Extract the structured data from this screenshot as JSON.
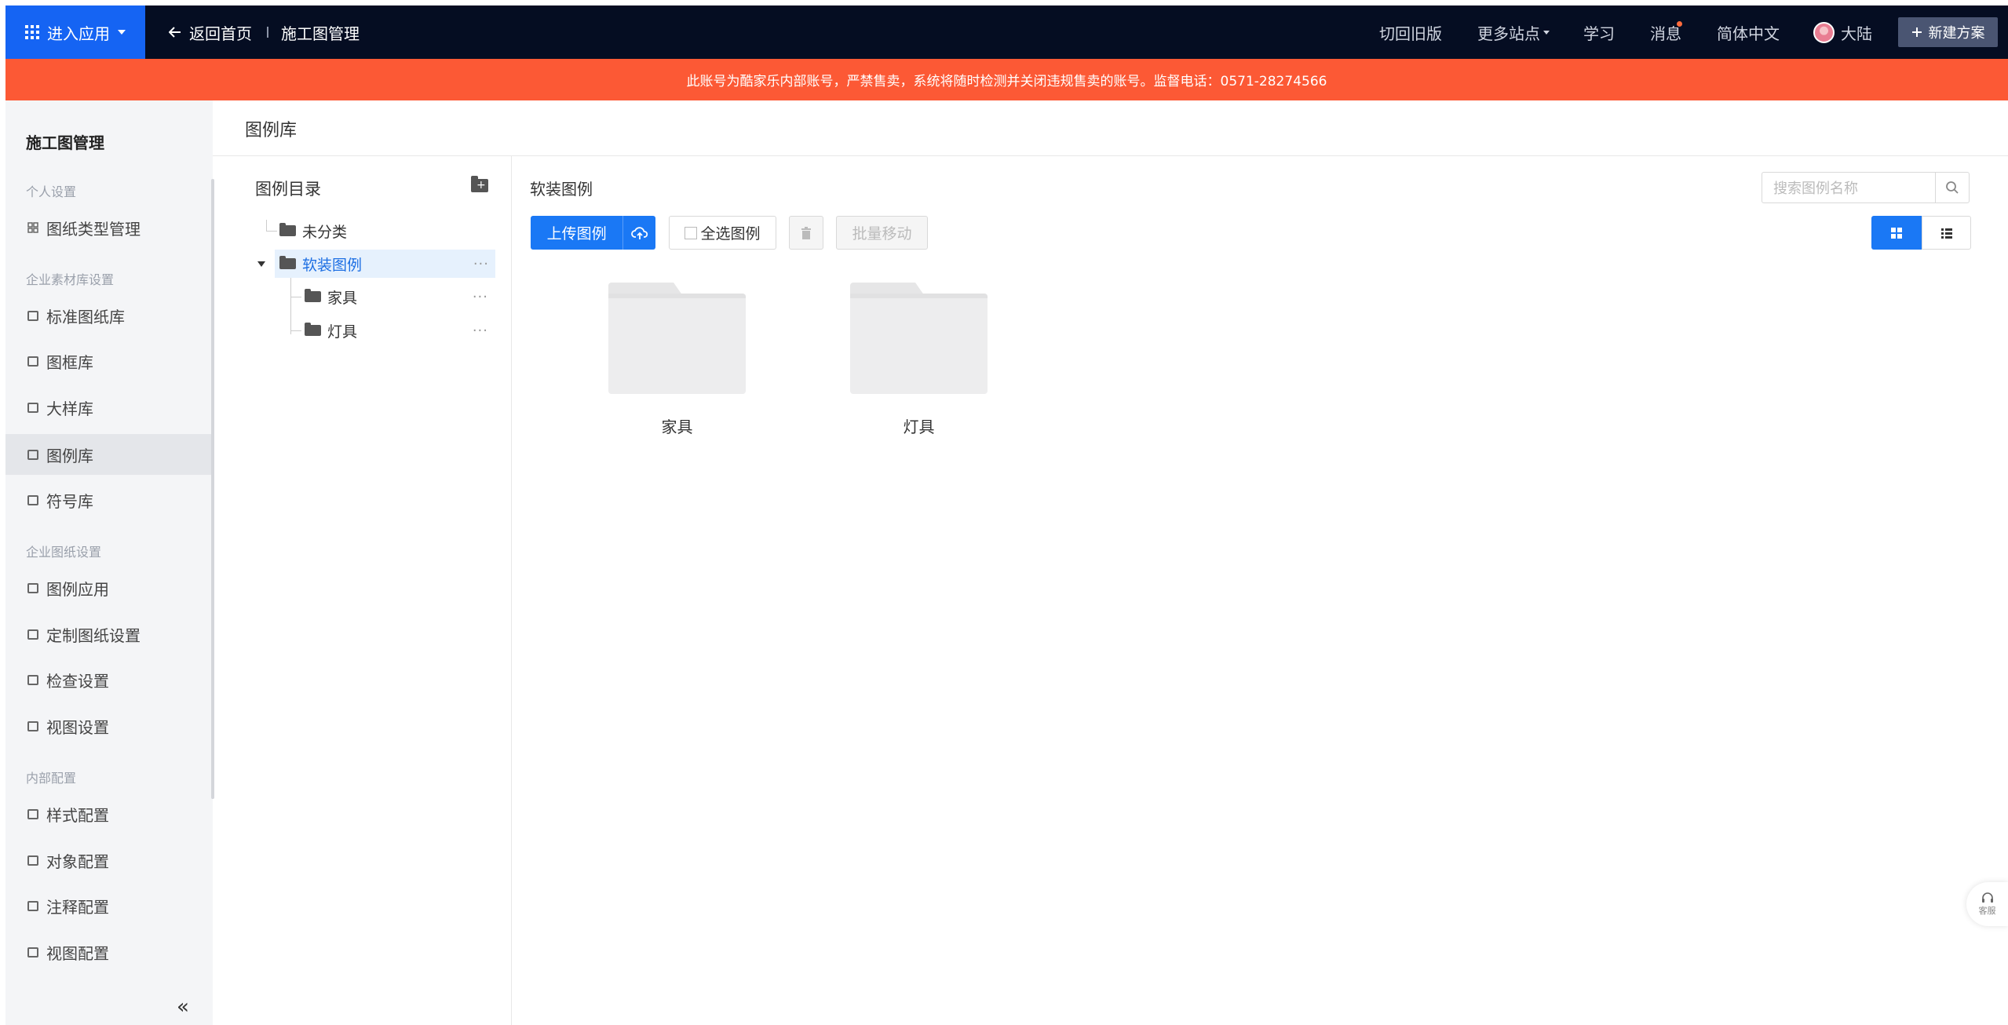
{
  "topbar": {
    "apps_label": "进入应用",
    "back_label": "返回首页",
    "breadcrumb": "施工图管理",
    "switch_old": "切回旧版",
    "more_sites": "更多站点",
    "learn": "学习",
    "messages": "消息",
    "language": "简体中文",
    "user_name": "大陆",
    "new_plan": "新建方案"
  },
  "banner": {
    "text": "此账号为酷家乐内部账号，严禁售卖，系统将随时检测并关闭违规售卖的账号。监督电话：0571-28274566"
  },
  "sidebar": {
    "title": "施工图管理",
    "groups": [
      "个人设置",
      "企业素材库设置",
      "企业图纸设置",
      "内部配置"
    ],
    "items": [
      {
        "label": "图纸类型管理",
        "icon": "grid-icon"
      },
      {
        "label": "标准图纸库",
        "icon": "document-icon"
      },
      {
        "label": "图框库",
        "icon": "frame-icon"
      },
      {
        "label": "大样库",
        "icon": "image-icon"
      },
      {
        "label": "图例库",
        "icon": "legend-icon",
        "active": true
      },
      {
        "label": "符号库",
        "icon": "symbol-icon"
      },
      {
        "label": "图例应用",
        "icon": "legend-icon"
      },
      {
        "label": "定制图纸设置",
        "icon": "document-icon"
      },
      {
        "label": "检查设置",
        "icon": "check-icon"
      },
      {
        "label": "视图设置",
        "icon": "document-icon"
      },
      {
        "label": "样式配置",
        "icon": "style-icon"
      },
      {
        "label": "对象配置",
        "icon": "object-icon"
      },
      {
        "label": "注释配置",
        "icon": "annotation-icon"
      },
      {
        "label": "视图配置",
        "icon": "view-icon"
      }
    ],
    "collapse": "«"
  },
  "page": {
    "title": "图例库"
  },
  "tree": {
    "title": "图例目录",
    "nodes": [
      {
        "label": "未分类"
      },
      {
        "label": "软装图例",
        "selected": true,
        "expanded": true
      },
      {
        "label": "家具"
      },
      {
        "label": "灯具"
      }
    ],
    "more": "···"
  },
  "content": {
    "section_title": "软装图例",
    "search_placeholder": "搜索图例名称",
    "upload_label": "上传图例",
    "select_all_label": "全选图例",
    "batch_move_label": "批量移动",
    "view_mode": "grid",
    "folders": [
      {
        "name": "家具"
      },
      {
        "name": "灯具"
      }
    ]
  },
  "service": {
    "label": "客服"
  },
  "colors": {
    "topbar": "#050d22",
    "accent": "#1a78f5",
    "banner": "#fc5935",
    "sidebar_bg": "#f4f5f7"
  }
}
